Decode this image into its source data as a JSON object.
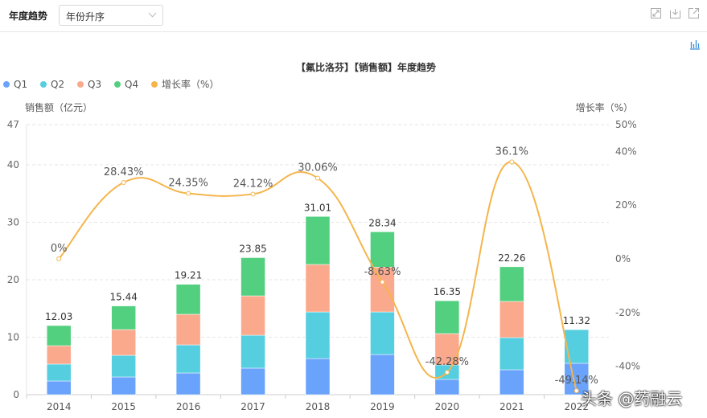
{
  "toolbar": {
    "title": "年度趋势",
    "sort_select": "年份升序",
    "icons": [
      "fullscreen-icon",
      "download-icon",
      "external-link-icon",
      "bar-chart-icon"
    ]
  },
  "watermark": "头条 @药融云",
  "colors": {
    "Q1": "#6aa3fb",
    "Q2": "#55cee0",
    "Q3": "#fba98c",
    "Q4": "#53d07f",
    "growth": "#f5b54c"
  },
  "chart_data": {
    "type": "bar",
    "title": "【氟比洛芬】【销售额】年度趋势",
    "ylabel": "销售额（亿元）",
    "y2label": "增长率（%）",
    "ylim": [
      0,
      47
    ],
    "yticks": [
      "0",
      "10",
      "20",
      "30",
      "40",
      "47"
    ],
    "y2lim": [
      -50,
      50
    ],
    "y2ticks": [
      "-40%",
      "-20%",
      "0%",
      "20%",
      "40%",
      "50%"
    ],
    "grid": true,
    "legend_placement": "top-left",
    "categories": [
      "2014",
      "2015",
      "2016",
      "2017",
      "2018",
      "2019",
      "2020",
      "2021",
      "2022"
    ],
    "series": [
      {
        "name": "Q1",
        "type": "bar",
        "stack": true,
        "values": [
          2.38,
          3.08,
          3.78,
          4.62,
          6.29,
          6.99,
          2.66,
          4.34,
          5.46
        ]
      },
      {
        "name": "Q2",
        "type": "bar",
        "stack": true,
        "values": [
          2.94,
          3.77,
          4.89,
          5.73,
          8.11,
          7.41,
          2.52,
          5.59,
          5.86
        ]
      },
      {
        "name": "Q3",
        "type": "bar",
        "stack": true,
        "values": [
          3.21,
          4.48,
          5.32,
          6.85,
          8.26,
          7.8,
          5.45,
          6.3,
          0
        ]
      },
      {
        "name": "Q4",
        "type": "bar",
        "stack": true,
        "values": [
          3.5,
          4.11,
          5.22,
          6.65,
          8.35,
          6.14,
          5.72,
          6.03,
          0
        ]
      },
      {
        "name": "增长率（%）",
        "type": "line",
        "smooth": true,
        "axis": "right",
        "values": [
          0,
          28.43,
          24.35,
          24.12,
          30.06,
          -8.63,
          -42.28,
          36.1,
          -49.14
        ]
      }
    ],
    "total_labels": [
      "12.03",
      "15.44",
      "19.21",
      "23.85",
      "31.01",
      "28.34",
      "16.35",
      "22.26",
      "11.32"
    ],
    "growth_labels": [
      "0%",
      "28.43%",
      "24.35%",
      "24.12%",
      "30.06%",
      "-8.63%",
      "-42.28%",
      "36.1%",
      "-49.14%"
    ]
  }
}
